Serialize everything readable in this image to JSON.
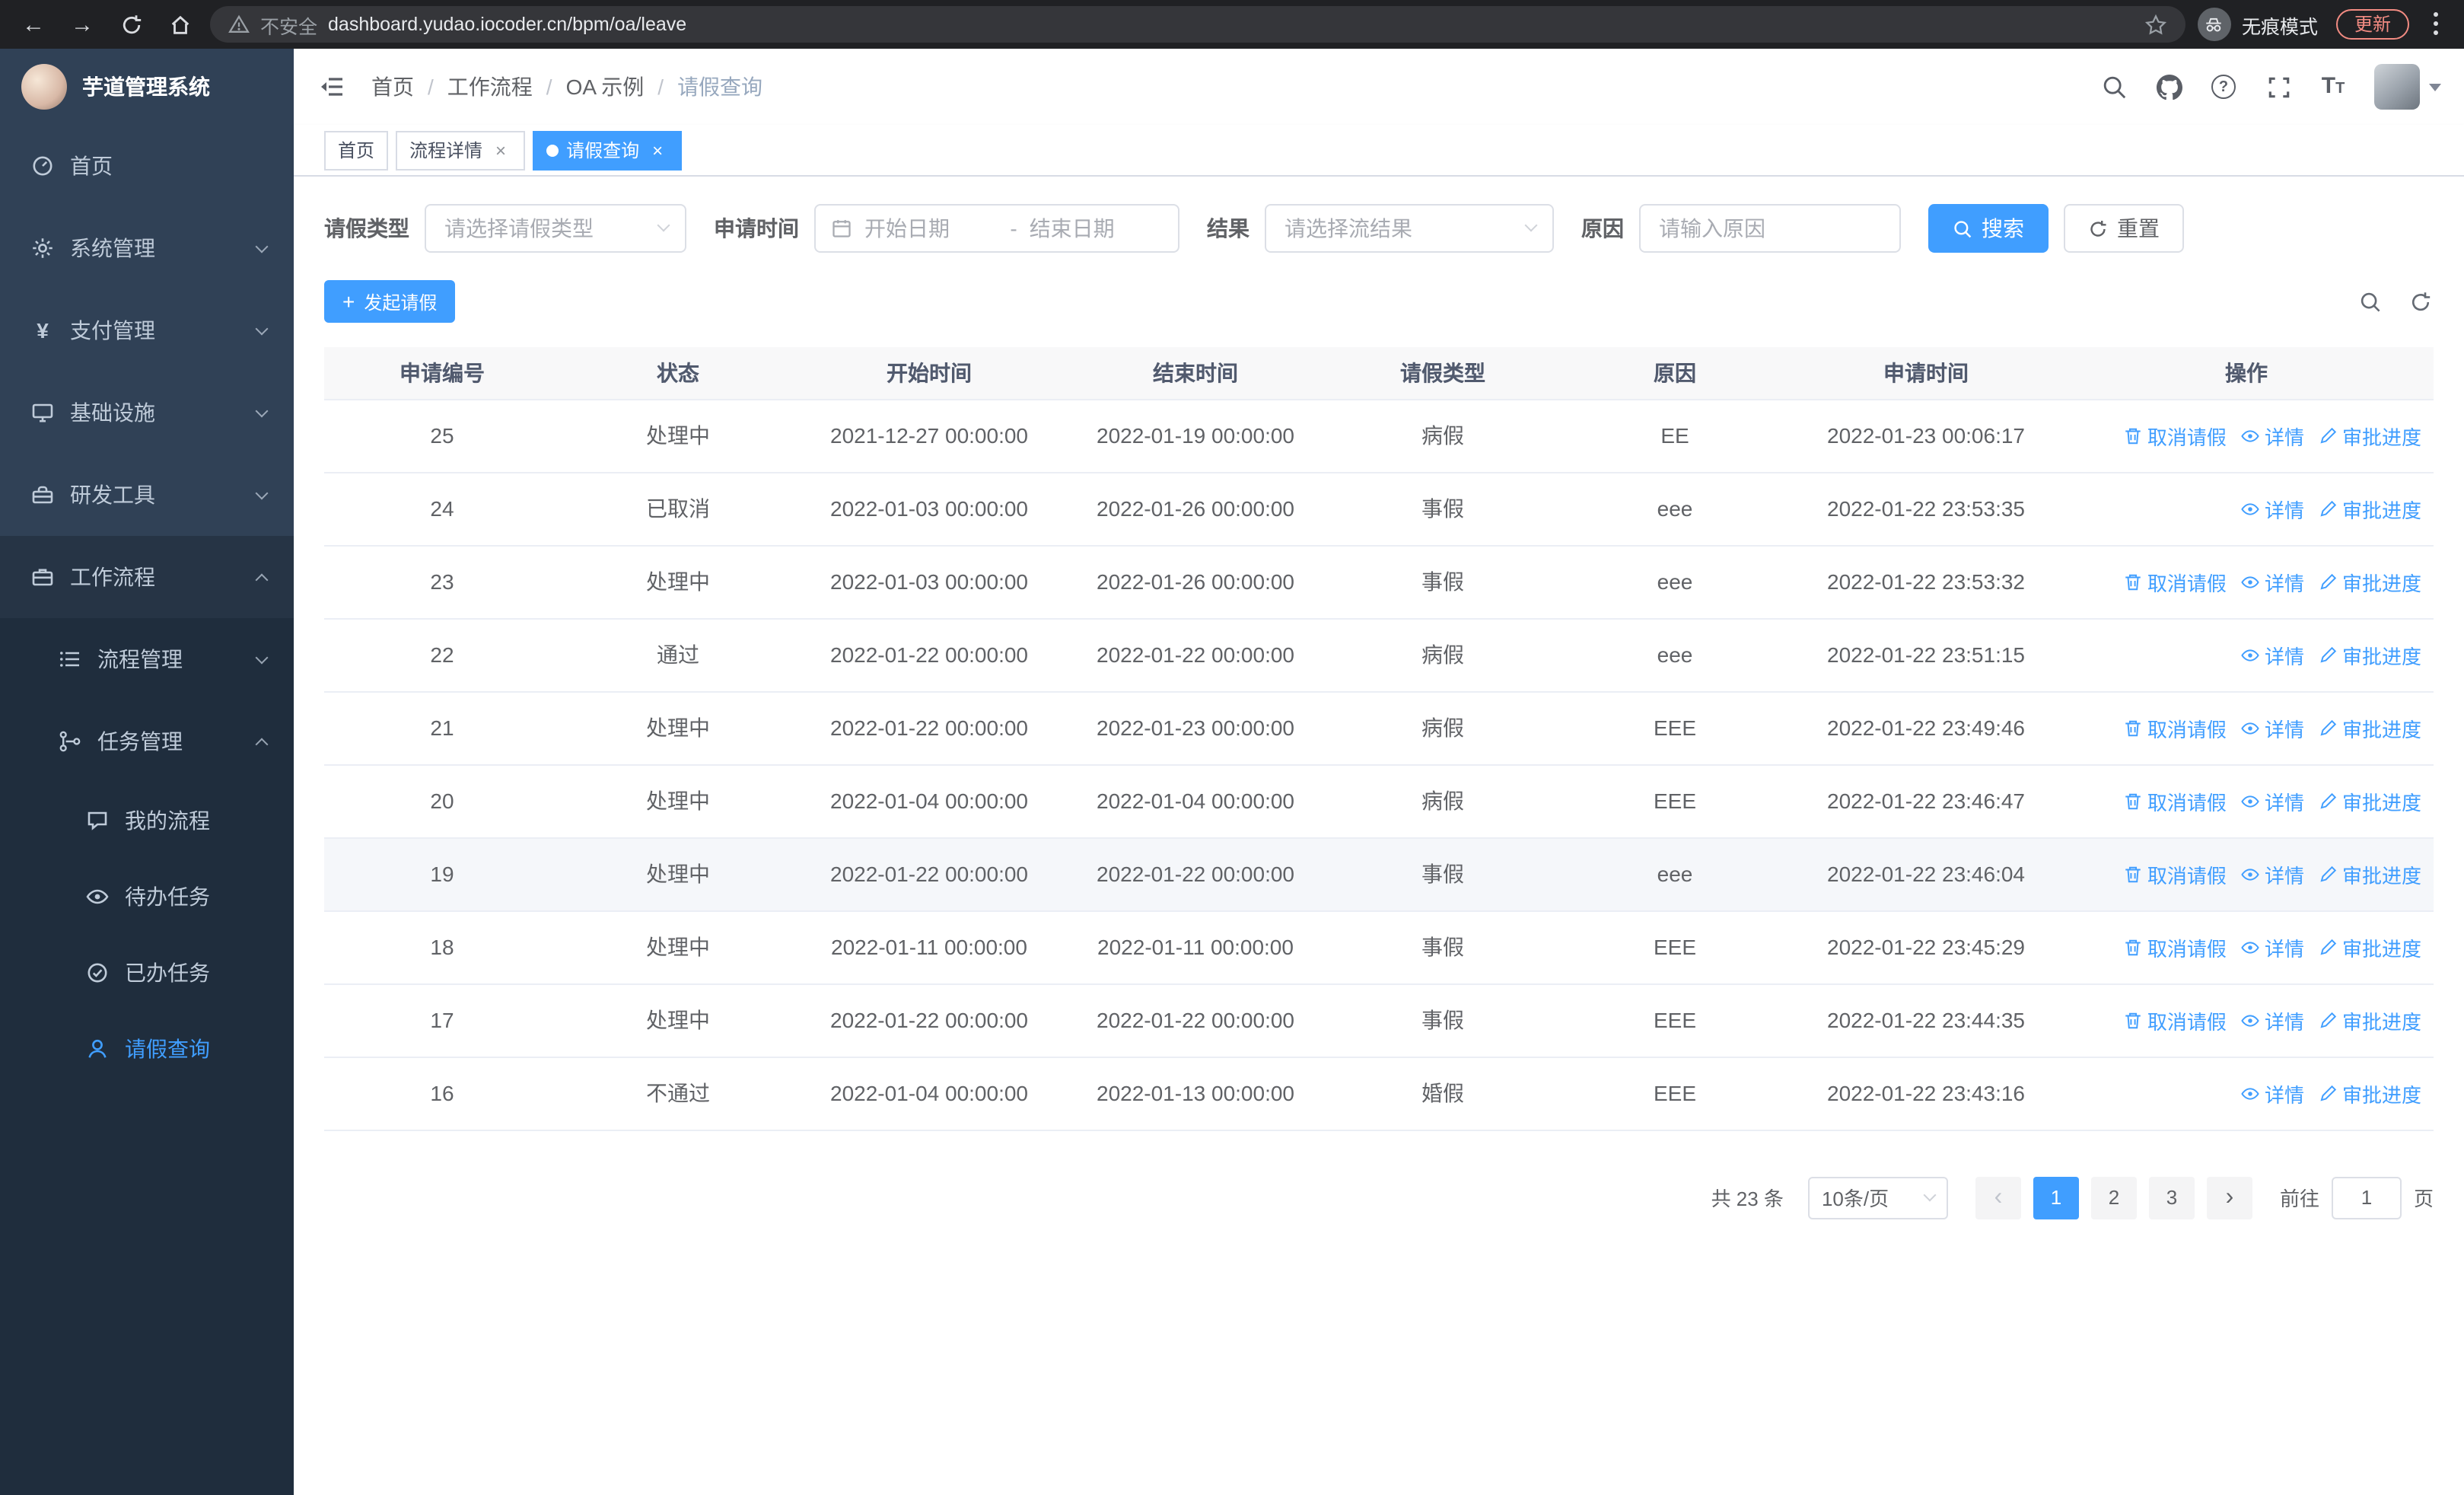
{
  "browser": {
    "security_label": "不安全",
    "url": "dashboard.yudao.iocoder.cn/bpm/oa/leave",
    "incognito_label": "无痕模式",
    "update_label": "更新"
  },
  "sidebar": {
    "app_title": "芋道管理系统",
    "items": [
      {
        "label": "首页"
      },
      {
        "label": "系统管理"
      },
      {
        "label": "支付管理"
      },
      {
        "label": "基础设施"
      },
      {
        "label": "研发工具"
      },
      {
        "label": "工作流程"
      }
    ],
    "submenu": [
      {
        "label": "流程管理"
      },
      {
        "label": "任务管理"
      }
    ],
    "task_items": [
      {
        "label": "我的流程"
      },
      {
        "label": "待办任务"
      },
      {
        "label": "已办任务"
      },
      {
        "label": "请假查询"
      }
    ]
  },
  "header": {
    "breadcrumb": [
      "首页",
      "工作流程",
      "OA 示例",
      "请假查询"
    ]
  },
  "tabs": [
    {
      "label": "首页"
    },
    {
      "label": "流程详情"
    },
    {
      "label": "请假查询"
    }
  ],
  "filters": {
    "leave_type_label": "请假类型",
    "leave_type_placeholder": "请选择请假类型",
    "apply_time_label": "申请时间",
    "start_date_placeholder": "开始日期",
    "date_separator": "-",
    "end_date_placeholder": "结束日期",
    "result_label": "结果",
    "result_placeholder": "请选择流结果",
    "reason_label": "原因",
    "reason_placeholder": "请输入原因",
    "search_label": "搜索",
    "reset_label": "重置"
  },
  "toolbar": {
    "create_label": "发起请假"
  },
  "table": {
    "columns": [
      "申请编号",
      "状态",
      "开始时间",
      "结束时间",
      "请假类型",
      "原因",
      "申请时间",
      "操作"
    ],
    "action_labels": {
      "cancel": "取消请假",
      "detail": "详情",
      "progress": "审批进度"
    },
    "rows": [
      {
        "id": "25",
        "status": "处理中",
        "start_time": "2021-12-27 00:00:00",
        "end_time": "2022-01-19 00:00:00",
        "leave_type": "病假",
        "reason": "EE",
        "apply_time": "2022-01-23 00:06:17",
        "cancellable": true,
        "highlighted": false
      },
      {
        "id": "24",
        "status": "已取消",
        "start_time": "2022-01-03 00:00:00",
        "end_time": "2022-01-26 00:00:00",
        "leave_type": "事假",
        "reason": "eee",
        "apply_time": "2022-01-22 23:53:35",
        "cancellable": false,
        "highlighted": false
      },
      {
        "id": "23",
        "status": "处理中",
        "start_time": "2022-01-03 00:00:00",
        "end_time": "2022-01-26 00:00:00",
        "leave_type": "事假",
        "reason": "eee",
        "apply_time": "2022-01-22 23:53:32",
        "cancellable": true,
        "highlighted": false
      },
      {
        "id": "22",
        "status": "通过",
        "start_time": "2022-01-22 00:00:00",
        "end_time": "2022-01-22 00:00:00",
        "leave_type": "病假",
        "reason": "eee",
        "apply_time": "2022-01-22 23:51:15",
        "cancellable": false,
        "highlighted": false
      },
      {
        "id": "21",
        "status": "处理中",
        "start_time": "2022-01-22 00:00:00",
        "end_time": "2022-01-23 00:00:00",
        "leave_type": "病假",
        "reason": "EEE",
        "apply_time": "2022-01-22 23:49:46",
        "cancellable": true,
        "highlighted": false
      },
      {
        "id": "20",
        "status": "处理中",
        "start_time": "2022-01-04 00:00:00",
        "end_time": "2022-01-04 00:00:00",
        "leave_type": "病假",
        "reason": "EEE",
        "apply_time": "2022-01-22 23:46:47",
        "cancellable": true,
        "highlighted": false
      },
      {
        "id": "19",
        "status": "处理中",
        "start_time": "2022-01-22 00:00:00",
        "end_time": "2022-01-22 00:00:00",
        "leave_type": "事假",
        "reason": "eee",
        "apply_time": "2022-01-22 23:46:04",
        "cancellable": true,
        "highlighted": true
      },
      {
        "id": "18",
        "status": "处理中",
        "start_time": "2022-01-11 00:00:00",
        "end_time": "2022-01-11 00:00:00",
        "leave_type": "事假",
        "reason": "EEE",
        "apply_time": "2022-01-22 23:45:29",
        "cancellable": true,
        "highlighted": false
      },
      {
        "id": "17",
        "status": "处理中",
        "start_time": "2022-01-22 00:00:00",
        "end_time": "2022-01-22 00:00:00",
        "leave_type": "事假",
        "reason": "EEE",
        "apply_time": "2022-01-22 23:44:35",
        "cancellable": true,
        "highlighted": false
      },
      {
        "id": "16",
        "status": "不通过",
        "start_time": "2022-01-04 00:00:00",
        "end_time": "2022-01-13 00:00:00",
        "leave_type": "婚假",
        "reason": "EEE",
        "apply_time": "2022-01-22 23:43:16",
        "cancellable": false,
        "highlighted": false
      }
    ]
  },
  "pagination": {
    "total_label": "共 23 条",
    "page_size_label": "10条/页",
    "pages": [
      "1",
      "2",
      "3"
    ],
    "goto_prefix": "前往",
    "goto_value": "1",
    "goto_suffix": "页"
  }
}
